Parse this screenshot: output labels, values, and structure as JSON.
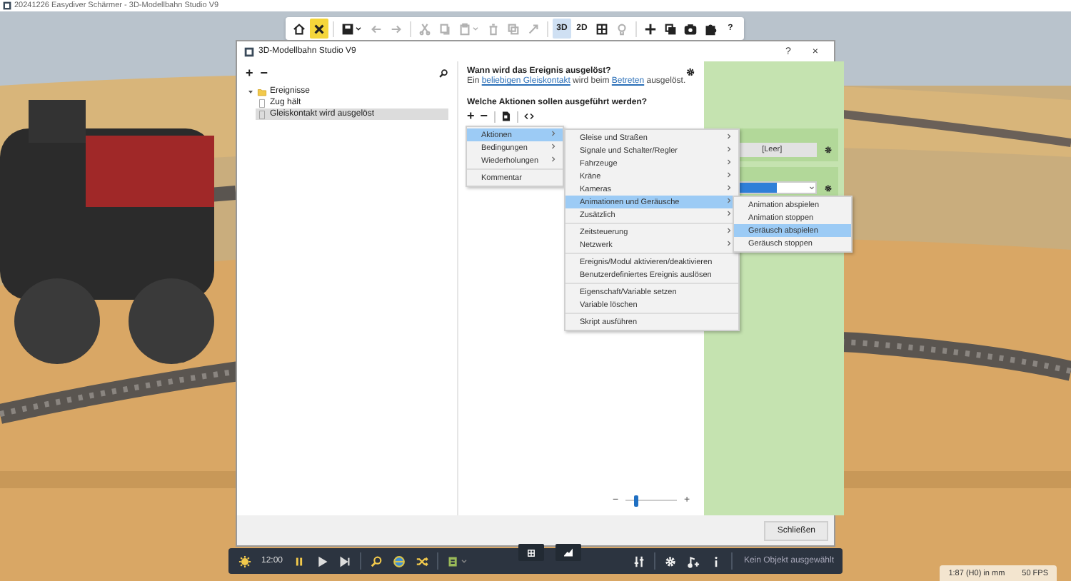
{
  "app_window": {
    "title": "20241226 Easydiver Schärmer - 3D-Modellbahn Studio V9"
  },
  "toolbar": [
    {
      "kind": "icon",
      "selected": false,
      "disabled": false
    },
    {
      "kind": "icon",
      "selected": true,
      "disabled": false
    },
    {
      "kind": "separator"
    },
    {
      "kind": "icon",
      "selected": false,
      "disabled": false,
      "dropdown": true
    },
    {
      "kind": "icon",
      "selected": false,
      "disabled": true
    },
    {
      "kind": "icon",
      "selected": false,
      "disabled": true
    },
    {
      "kind": "separator"
    },
    {
      "kind": "icon",
      "selected": false,
      "disabled": true
    },
    {
      "kind": "icon",
      "selected": false,
      "disabled": true
    },
    {
      "kind": "icon",
      "selected": false,
      "disabled": true,
      "dropdown": true
    },
    {
      "kind": "icon",
      "selected": false,
      "disabled": true
    },
    {
      "kind": "icon",
      "selected": false,
      "disabled": true
    },
    {
      "kind": "icon",
      "selected": false,
      "disabled": true
    },
    {
      "kind": "separator"
    },
    {
      "kind": "text",
      "label": "3D",
      "selected": true,
      "disabled": false
    },
    {
      "kind": "text",
      "label": "2D",
      "selected": false,
      "disabled": false
    },
    {
      "kind": "icon",
      "selected": false,
      "disabled": false
    },
    {
      "kind": "icon",
      "selected": false,
      "disabled": true
    },
    {
      "kind": "separator"
    },
    {
      "kind": "icon",
      "selected": false,
      "disabled": false
    },
    {
      "kind": "icon",
      "selected": false,
      "disabled": false
    },
    {
      "kind": "icon",
      "selected": false,
      "disabled": false
    },
    {
      "kind": "icon",
      "selected": false,
      "disabled": false
    },
    {
      "kind": "text",
      "label": "?",
      "selected": false,
      "disabled": false
    }
  ],
  "dialog": {
    "title": "3D-Modellbahn Studio V9",
    "help": "?",
    "close": "×",
    "tree_toolbar": [
      "+",
      "−"
    ],
    "tree": [
      {
        "label": "Ereignisse",
        "expanded": true,
        "selected": false,
        "children": [
          {
            "label": "Zug hält",
            "selected": false
          },
          {
            "label": "Gleiskontakt wird ausgelöst",
            "selected": true
          }
        ]
      }
    ],
    "trigger_heading": "Wann wird das Ereignis ausgelöst?",
    "trigger_sentence": [
      "Ein ",
      {
        "link": "beliebigen Gleiskontakt"
      },
      " wird beim ",
      {
        "link": "Betreten"
      },
      " ausgelöst."
    ],
    "actions_heading": "Welche Aktionen sollen ausgeführt werden?",
    "actions_toolbar": [
      "+",
      "−"
    ],
    "side_panel": {
      "empty_field": "[Leer]"
    },
    "zoom": {
      "minus": "−",
      "plus": "+",
      "level": 0.2
    },
    "close_button": "Schließen"
  },
  "menus": [
    {
      "items": [
        {
          "kind": "item",
          "label": "Aktionen",
          "submenu": true,
          "selected": true
        },
        {
          "kind": "item",
          "label": "Bedingungen",
          "submenu": true,
          "selected": false
        },
        {
          "kind": "item",
          "label": "Wiederholungen",
          "submenu": true,
          "selected": false
        },
        {
          "kind": "separator"
        },
        {
          "kind": "item",
          "label": "Kommentar",
          "submenu": false,
          "selected": false
        }
      ]
    },
    {
      "items": [
        {
          "kind": "item",
          "label": "Gleise und Straßen",
          "submenu": true,
          "selected": false
        },
        {
          "kind": "item",
          "label": "Signale und Schalter/Regler",
          "submenu": true,
          "selected": false
        },
        {
          "kind": "item",
          "label": "Fahrzeuge",
          "submenu": true,
          "selected": false
        },
        {
          "kind": "item",
          "label": "Kräne",
          "submenu": true,
          "selected": false
        },
        {
          "kind": "item",
          "label": "Kameras",
          "submenu": true,
          "selected": false
        },
        {
          "kind": "item",
          "label": "Animationen und Geräusche",
          "submenu": true,
          "selected": true
        },
        {
          "kind": "item",
          "label": "Zusätzlich",
          "submenu": true,
          "selected": false
        },
        {
          "kind": "separator"
        },
        {
          "kind": "item",
          "label": "Zeitsteuerung",
          "submenu": true,
          "selected": false
        },
        {
          "kind": "item",
          "label": "Netzwerk",
          "submenu": true,
          "selected": false
        },
        {
          "kind": "separator"
        },
        {
          "kind": "item",
          "label": "Ereignis/Modul aktivieren/deaktivieren",
          "submenu": false,
          "selected": false
        },
        {
          "kind": "item",
          "label": "Benutzerdefiniertes Ereignis auslösen",
          "submenu": false,
          "selected": false
        },
        {
          "kind": "separator"
        },
        {
          "kind": "item",
          "label": "Eigenschaft/Variable setzen",
          "submenu": false,
          "selected": false
        },
        {
          "kind": "item",
          "label": "Variable löschen",
          "submenu": false,
          "selected": false
        },
        {
          "kind": "separator"
        },
        {
          "kind": "item",
          "label": "Skript ausführen",
          "submenu": false,
          "selected": false
        }
      ]
    },
    {
      "items": [
        {
          "kind": "item",
          "label": "Animation abspielen",
          "submenu": false,
          "selected": false
        },
        {
          "kind": "item",
          "label": "Animation stoppen",
          "submenu": false,
          "selected": false
        },
        {
          "kind": "item",
          "label": "Geräusch abspielen",
          "submenu": false,
          "selected": true
        },
        {
          "kind": "item",
          "label": "Geräusch stoppen",
          "submenu": false,
          "selected": false
        }
      ]
    }
  ],
  "taskbar": {
    "time": "12:00",
    "status": "Kein Objekt ausgewählt"
  },
  "scale_info": {
    "scale": "1:87 (H0) in mm",
    "fps": "50 FPS"
  }
}
